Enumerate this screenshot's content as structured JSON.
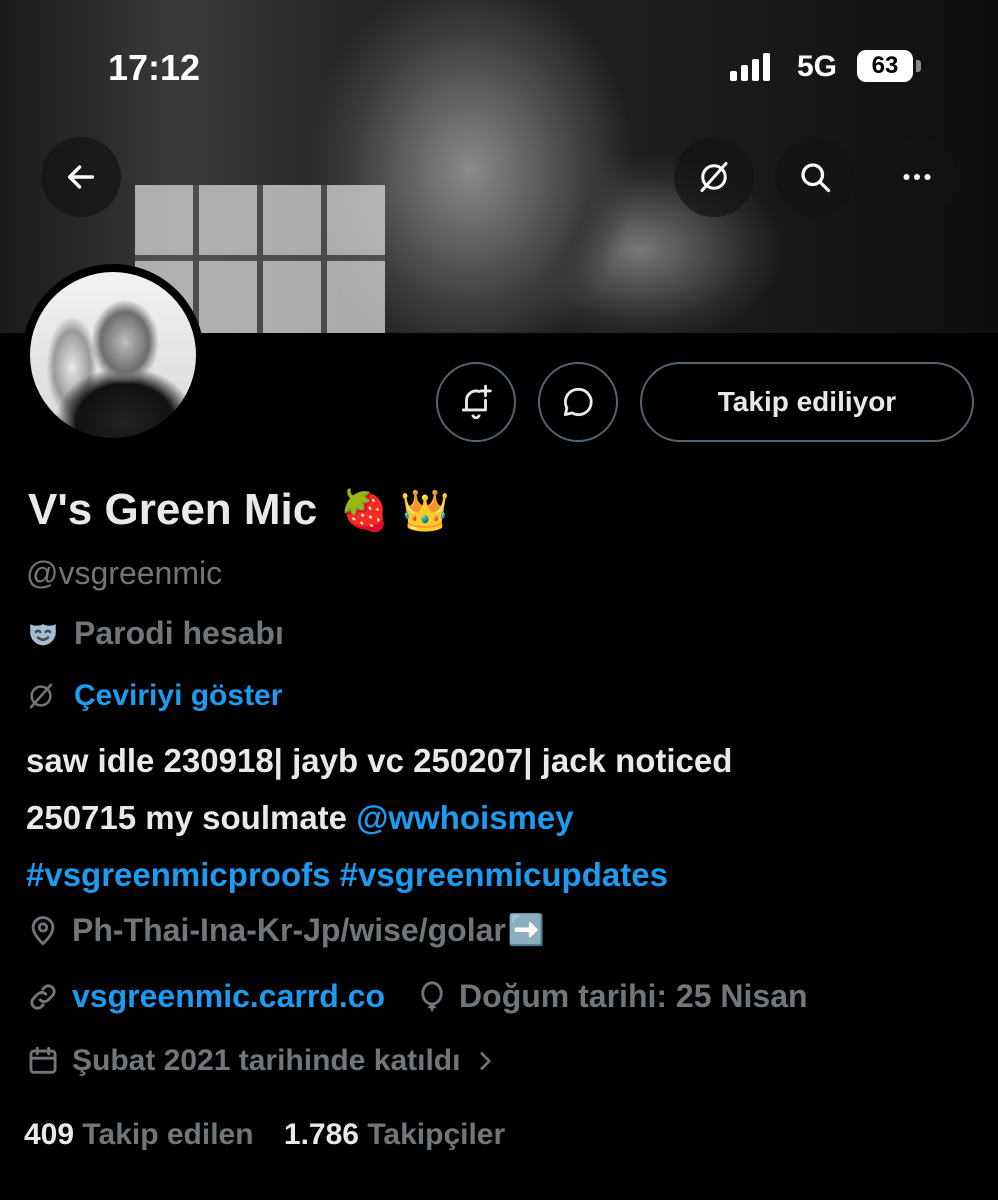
{
  "status_bar": {
    "time": "17:12",
    "network": "5G",
    "battery": "63"
  },
  "header": {
    "back_icon": "arrow-left-icon",
    "translate_icon": "translate-off-icon",
    "search_icon": "search-icon",
    "more_icon": "more-horizontal-icon"
  },
  "actions": {
    "notify_icon": "bell-plus-icon",
    "message_icon": "message-bubble-icon",
    "follow_label": "Takip ediliyor"
  },
  "profile": {
    "display_name": "V's Green Mic",
    "name_emojis": "🍓 👑",
    "handle": "@vsgreenmic",
    "parody_label": "Parodi hesabı",
    "translate_label": "Çeviriyi göster",
    "bio_line1": "saw idle 230918| jayb vc 250207| jack noticed",
    "bio_line2_text": "250715 my soulmate ",
    "bio_line2_mention": "@wwhoismey",
    "bio_line3": "#vsgreenmicproofs #vsgreenmicupdates",
    "location": "Ph-Thai-Ina-Kr-Jp/wise/golar",
    "location_emoji": "➡️",
    "website": "vsgreenmic.carrd.co",
    "birthday": "Doğum tarihi: 25 Nisan",
    "joined": "Şubat 2021 tarihinde katıldı"
  },
  "stats": {
    "following_count": "409",
    "following_label": "Takip edilen",
    "followers_count": "1.786",
    "followers_label": "Takipçiler"
  },
  "colors": {
    "accent": "#1d9bf0",
    "text_primary": "#e7e9ea",
    "text_secondary": "#71767b",
    "background": "#000000"
  }
}
